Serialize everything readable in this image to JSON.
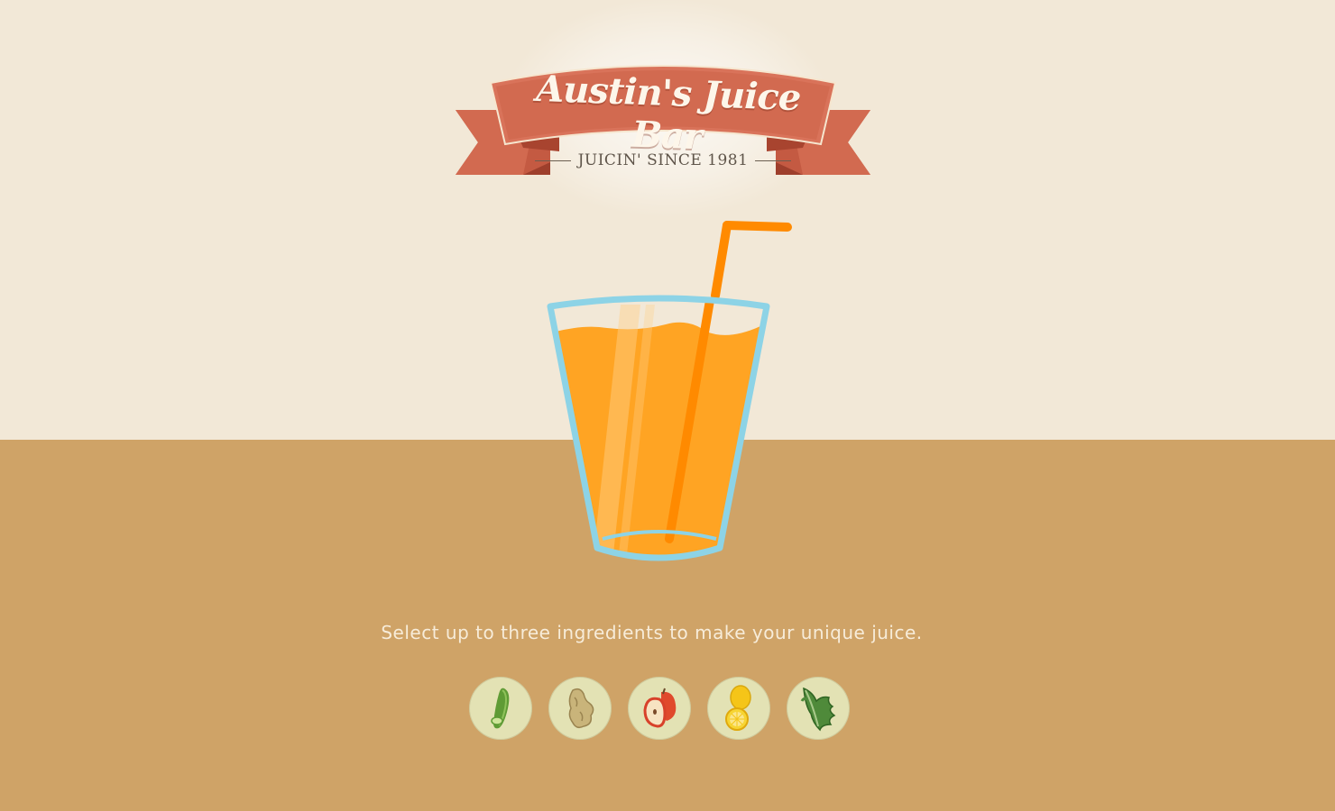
{
  "header": {
    "title": "Austin's Juice Bar",
    "tagline": "JUICIN' SINCE 1981"
  },
  "colors": {
    "wall": "#f2e8d7",
    "counter": "#cfa367",
    "banner": "#d26a50",
    "juice": "#ffa423",
    "straw": "#ff8a00",
    "glass_outline": "#8dd3e6",
    "ingredient_bg": "#e3e2b4"
  },
  "main": {
    "instruction": "Select up to three ingredients to make your unique juice."
  },
  "ingredients": [
    {
      "icon": "cucumber-icon"
    },
    {
      "icon": "ginger-icon"
    },
    {
      "icon": "apple-icon"
    },
    {
      "icon": "lemon-icon"
    },
    {
      "icon": "kale-icon"
    }
  ]
}
